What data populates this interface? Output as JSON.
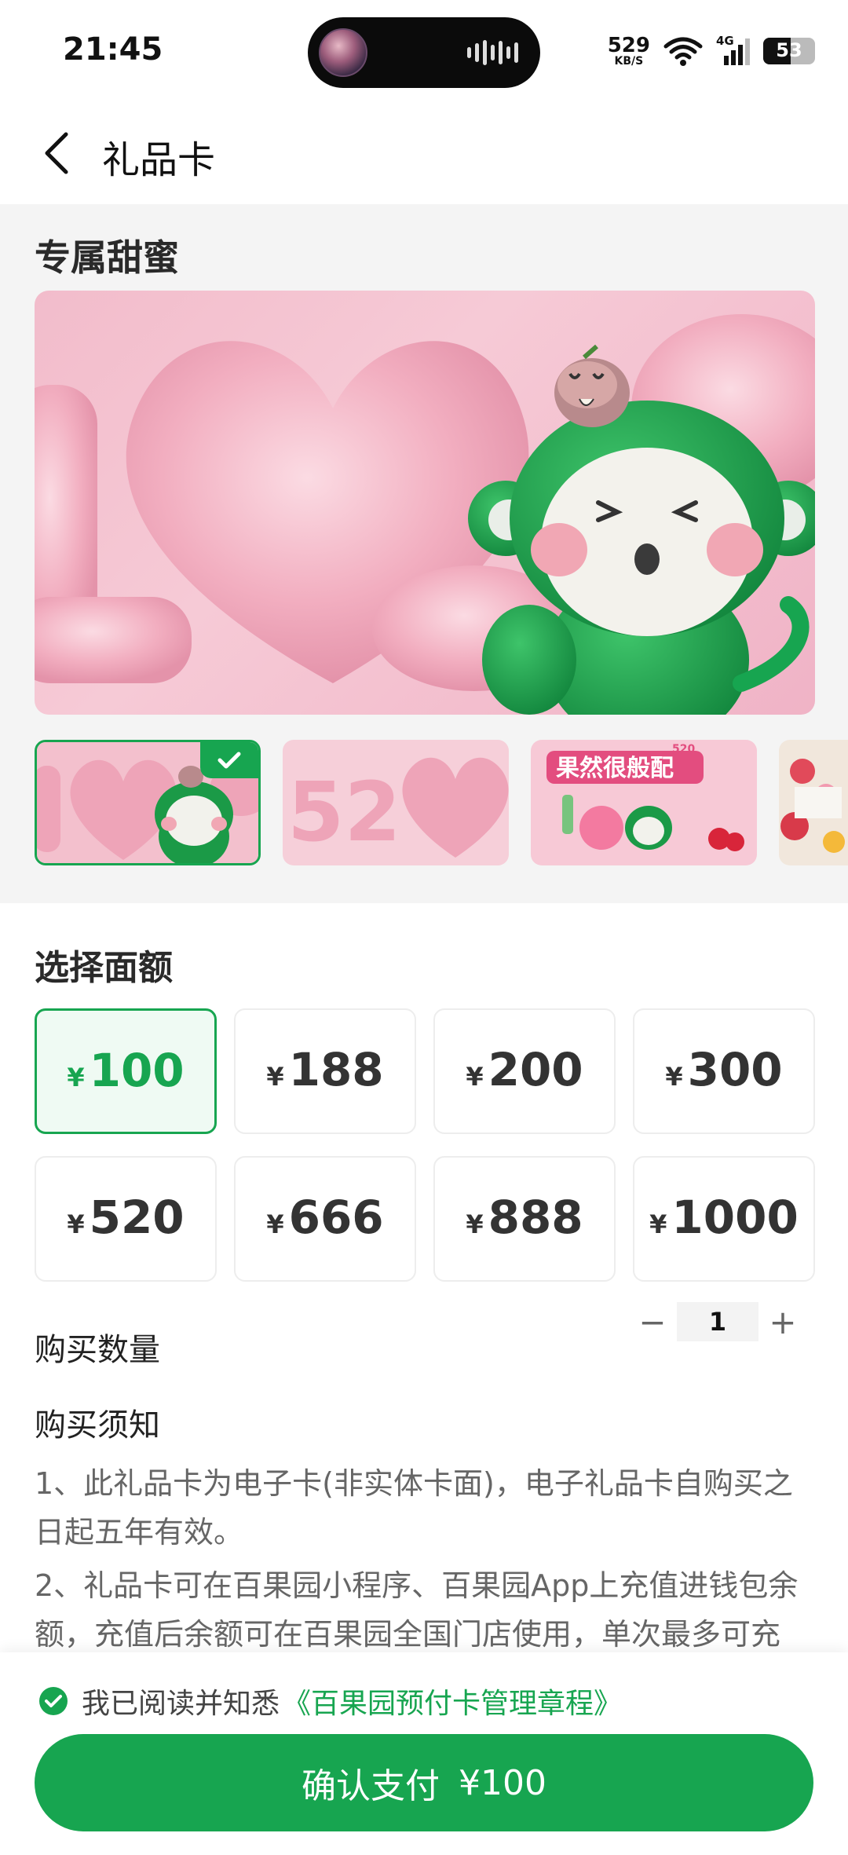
{
  "status_bar": {
    "time": "21:45",
    "net_speed": "529",
    "net_unit": "KB/S",
    "network": "4G",
    "battery": "53",
    "battery_level": 0.53
  },
  "header": {
    "title": "礼品卡",
    "back_icon": "chevron-left-icon"
  },
  "card_section": {
    "title": "专属甜蜜",
    "selected_index": 0,
    "thumbnails": [
      {
        "theme": "love-monkey",
        "selected": true
      },
      {
        "theme": "520-hearts",
        "selected": false
      },
      {
        "theme": "guo-ran-hen-ban-pei",
        "text": "果然很般配",
        "badge": "520",
        "selected": false
      },
      {
        "theme": "flowers",
        "selected": false
      }
    ]
  },
  "denomination": {
    "title": "选择面额",
    "currency": "¥",
    "options": [
      {
        "amount": "100",
        "selected": true
      },
      {
        "amount": "188",
        "selected": false
      },
      {
        "amount": "200",
        "selected": false
      },
      {
        "amount": "300",
        "selected": false
      },
      {
        "amount": "520",
        "selected": false
      },
      {
        "amount": "666",
        "selected": false
      },
      {
        "amount": "888",
        "selected": false
      },
      {
        "amount": "1000",
        "selected": false
      }
    ]
  },
  "quantity": {
    "label": "购买数量",
    "value": "1",
    "minus": "−",
    "plus": "+"
  },
  "notice": {
    "title": "购买须知",
    "items": [
      "1、此礼品卡为电子卡(非实体卡面)，电子礼品卡自购买之日起五年有效。",
      "2、礼品卡可在百果园小程序、百果园App上充值进钱包余额，充值后余额可在百果园全国门店使用，单次最多可充"
    ]
  },
  "agreement": {
    "text": "我已阅读并知悉",
    "link": "《百果园预付卡管理章程》",
    "checked": true
  },
  "pay": {
    "label": "确认支付",
    "amount": "¥100"
  },
  "colors": {
    "brand_green": "#17a550",
    "selected_bg": "#effaf3",
    "card_pink": "#f4c2cf"
  }
}
